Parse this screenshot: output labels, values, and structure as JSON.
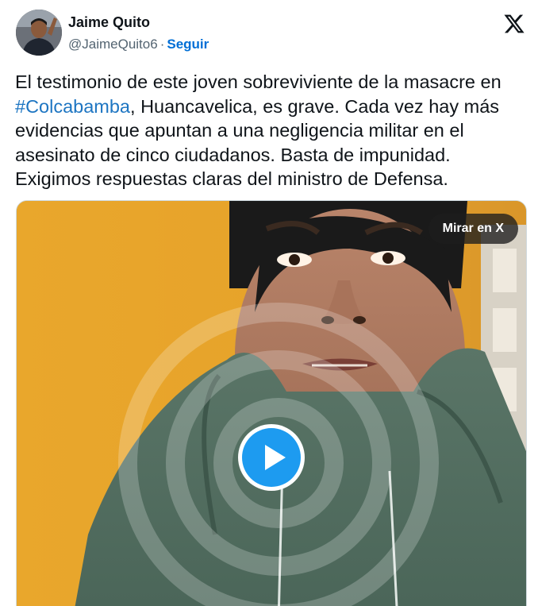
{
  "author": {
    "name": "Jaime Quito",
    "handle": "@JaimeQuito6",
    "separator": "·",
    "follow_label": "Seguir"
  },
  "tweet": {
    "text_before": "El testimonio de este joven sobreviviente de la masacre en ",
    "hashtag": "#Colcabamba",
    "text_after": ", Huancavelica, es grave. Cada vez hay más evidencias que apuntan a una negligencia militar en el asesinato de cinco ciudadanos. Basta de impunidad. Exigimos respuestas claras del ministro de Defensa."
  },
  "media": {
    "watch_label": "Mirar en X",
    "play_icon": "play-icon"
  },
  "icons": {
    "brand": "x-logo-icon"
  },
  "colors": {
    "link": "#1d75c2",
    "follow": "#006fd6",
    "play": "#1d9bf0",
    "muted": "#536471"
  }
}
